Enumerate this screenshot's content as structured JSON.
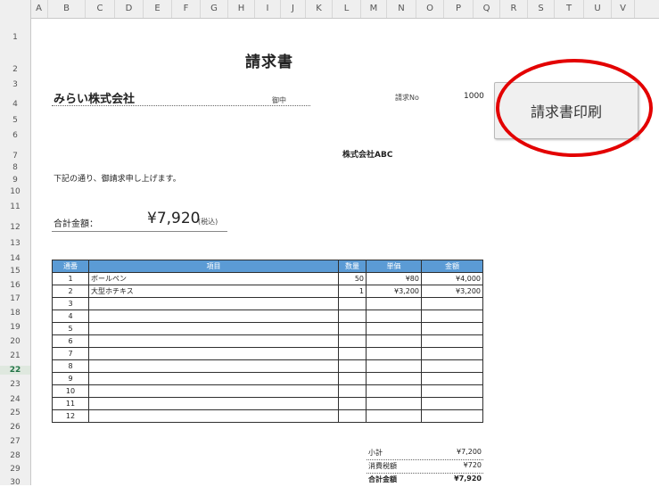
{
  "columns": [
    "A",
    "B",
    "C",
    "D",
    "E",
    "F",
    "G",
    "H",
    "I",
    "J",
    "K",
    "L",
    "M",
    "N",
    "O",
    "P",
    "Q",
    "R",
    "S",
    "T",
    "U",
    "V"
  ],
  "rows": [
    "1",
    "2",
    "3",
    "4",
    "5",
    "6",
    "7",
    "8",
    "9",
    "10",
    "11",
    "12",
    "13",
    "14",
    "15",
    "16",
    "17",
    "18",
    "19",
    "20",
    "21",
    "22",
    "23",
    "24",
    "25",
    "26",
    "27",
    "28",
    "29",
    "30"
  ],
  "selected_row": "22",
  "invoice": {
    "title": "請求書",
    "customer": "みらい株式会社",
    "honorific": "御中",
    "number_label": "請求No",
    "number_value": "1000",
    "issuer": "株式会社ABC",
    "message": "下記の通り、御請求申し上げます。",
    "total_label": "合計金額：",
    "total_value": "¥7,920",
    "total_tax_note": "(税込)"
  },
  "print_button": {
    "label": "請求書印刷"
  },
  "accent_colors": {
    "header_blue": "#5b9bd5",
    "highlight_red": "#e30000"
  },
  "table": {
    "headers": [
      "通番",
      "項目",
      "数量",
      "単価",
      "金額"
    ],
    "rows": [
      [
        "1",
        "ボールペン",
        "50",
        "¥80",
        "¥4,000"
      ],
      [
        "2",
        "大型ホチキス",
        "1",
        "¥3,200",
        "¥3,200"
      ],
      [
        "3",
        "",
        "",
        "",
        ""
      ],
      [
        "4",
        "",
        "",
        "",
        ""
      ],
      [
        "5",
        "",
        "",
        "",
        ""
      ],
      [
        "6",
        "",
        "",
        "",
        ""
      ],
      [
        "7",
        "",
        "",
        "",
        ""
      ],
      [
        "8",
        "",
        "",
        "",
        ""
      ],
      [
        "9",
        "",
        "",
        "",
        ""
      ],
      [
        "10",
        "",
        "",
        "",
        ""
      ],
      [
        "11",
        "",
        "",
        "",
        ""
      ],
      [
        "12",
        "",
        "",
        "",
        ""
      ]
    ]
  },
  "summary": [
    {
      "label": "小計",
      "value": "¥7,200"
    },
    {
      "label": "消費税額",
      "value": "¥720"
    },
    {
      "label": "合計金額",
      "value": "¥7,920"
    }
  ]
}
